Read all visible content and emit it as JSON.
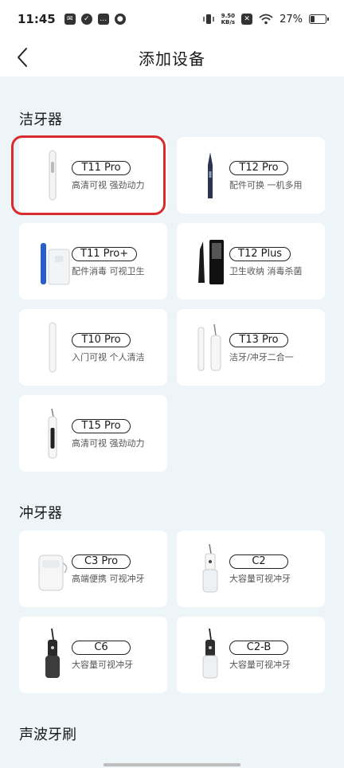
{
  "status": {
    "time": "11:45",
    "netspeed_value": "9.50",
    "netspeed_unit": "KB/s",
    "battery": "27%",
    "battery_level": 0.27
  },
  "header": {
    "title": "添加设备"
  },
  "sections": {
    "cleaner": {
      "title": "洁牙器"
    },
    "flosser": {
      "title": "冲牙器"
    },
    "sonic": {
      "title": "声波牙刷"
    }
  },
  "devices": {
    "t11pro": {
      "model": "T11 Pro",
      "desc": "高清可视 强劲动力"
    },
    "t12pro": {
      "model": "T12 Pro",
      "desc": "配件可换 一机多用"
    },
    "t11proplus": {
      "model": "T11 Pro+",
      "desc": "配件消毒 可视卫生"
    },
    "t12plus": {
      "model": "T12 Plus",
      "desc": "卫生收纳 消毒杀菌"
    },
    "t10pro": {
      "model": "T10 Pro",
      "desc": "入门可视 个人清洁"
    },
    "t13pro": {
      "model": "T13 Pro",
      "desc": "洁牙/冲牙二合一"
    },
    "t15pro": {
      "model": "T15 Pro",
      "desc": "高清可视 强劲动力"
    },
    "c3pro": {
      "model": "C3 Pro",
      "desc": "高端便携 可视冲牙"
    },
    "c2": {
      "model": "C2",
      "desc": "大容量可视冲牙"
    },
    "c6": {
      "model": "C6",
      "desc": "大容量可视冲牙"
    },
    "c2b": {
      "model": "C2-B",
      "desc": "大容量可视冲牙"
    }
  }
}
